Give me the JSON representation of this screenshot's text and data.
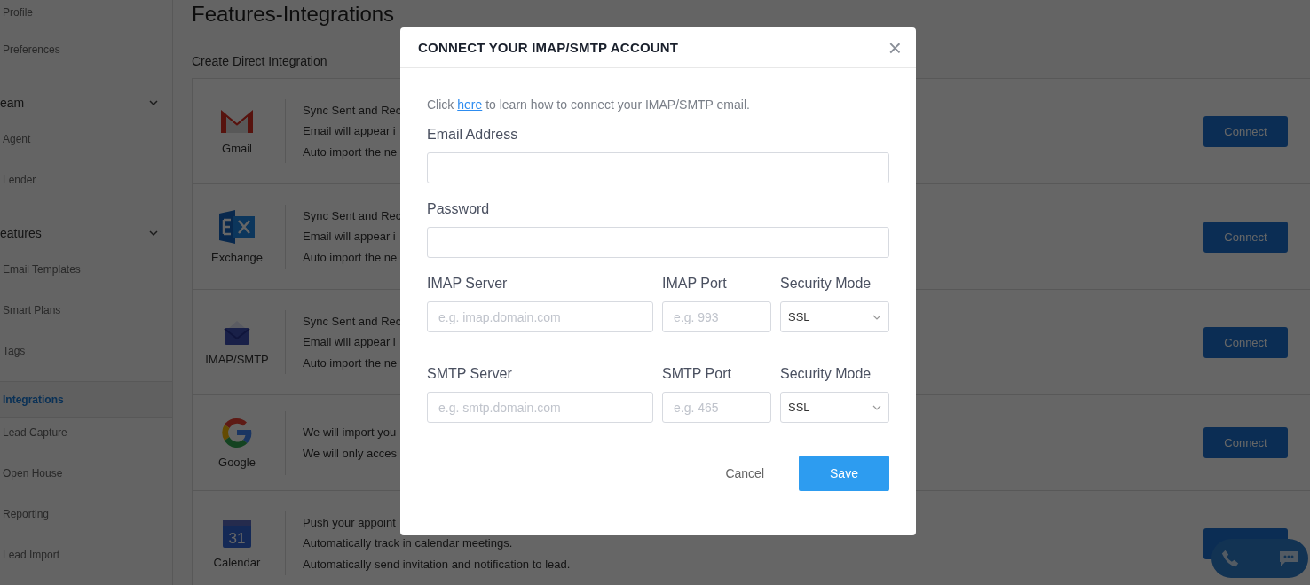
{
  "sidebar": {
    "items": [
      {
        "kind": "link",
        "label": "Profile",
        "selected": false
      },
      {
        "kind": "link",
        "label": "Preferences",
        "selected": false
      },
      {
        "kind": "section",
        "label": "eam",
        "expanded": true
      },
      {
        "kind": "link",
        "label": "Agent",
        "selected": false
      },
      {
        "kind": "link",
        "label": "Lender",
        "selected": false
      },
      {
        "kind": "section",
        "label": "eatures",
        "expanded": true
      },
      {
        "kind": "link",
        "label": "Email Templates",
        "selected": false
      },
      {
        "kind": "link",
        "label": "Smart Plans",
        "selected": false
      },
      {
        "kind": "link",
        "label": "Tags",
        "selected": false
      },
      {
        "kind": "link",
        "label": "Integrations",
        "selected": true
      },
      {
        "kind": "link",
        "label": "Lead Capture",
        "selected": false
      },
      {
        "kind": "link",
        "label": "Open House",
        "selected": false
      },
      {
        "kind": "link",
        "label": "Reporting",
        "selected": false
      },
      {
        "kind": "link",
        "label": "Lead Import",
        "selected": false
      }
    ]
  },
  "page_title": "Features-Integrations",
  "section_title": "Create Direct Integration",
  "integrations": [
    {
      "kind": "gmail",
      "name": "Gmail",
      "lines": [
        "Sync Sent and Rec",
        "Email will appear i",
        "Auto import the ne"
      ],
      "button": "Connect"
    },
    {
      "kind": "exchange",
      "name": "Exchange",
      "lines": [
        "Sync Sent and Rec",
        "Email will appear i",
        "Auto import the ne"
      ],
      "button": "Connect"
    },
    {
      "kind": "imap",
      "name": "IMAP/SMTP",
      "lines": [
        "Sync Sent and Rec",
        "Email will appear i",
        "Auto import the ne"
      ],
      "button": "Connect"
    },
    {
      "kind": "google",
      "name": "Google",
      "lines": [
        "We will import you",
        "We will only acces"
      ],
      "button": "Connect"
    },
    {
      "kind": "calendar",
      "name": "Calendar",
      "icon_text": "31",
      "lines": [
        "Push your appoint",
        "Automatically track in calendar meetings.",
        "Automatically send invitation and notification to lead."
      ]
    }
  ],
  "modal": {
    "title": "CONNECT YOUR IMAP/SMTP ACCOUNT",
    "close": "×",
    "help": {
      "before": "Click ",
      "link": "here",
      "after": " to learn how to connect your IMAP/SMTP email."
    },
    "rows": [
      [
        {
          "kind": "input",
          "label": "Email Address"
        }
      ],
      [
        {
          "kind": "input",
          "label": "Password"
        }
      ],
      [
        {
          "kind": "input",
          "label": "IMAP Server",
          "placeholder": "e.g. imap.domain.com"
        },
        {
          "kind": "input",
          "label": "IMAP Port",
          "placeholder": "e.g. 993"
        },
        {
          "kind": "select",
          "label": "Security Mode",
          "value": "SSL"
        }
      ],
      [
        {
          "kind": "input",
          "label": "SMTP Server",
          "placeholder": "e.g. smtp.domain.com"
        },
        {
          "kind": "input",
          "label": "SMTP Port",
          "placeholder": "e.g. 465"
        },
        {
          "kind": "select",
          "label": "Security Mode",
          "value": "SSL"
        }
      ]
    ],
    "cancel": "Cancel",
    "save": "Save"
  }
}
